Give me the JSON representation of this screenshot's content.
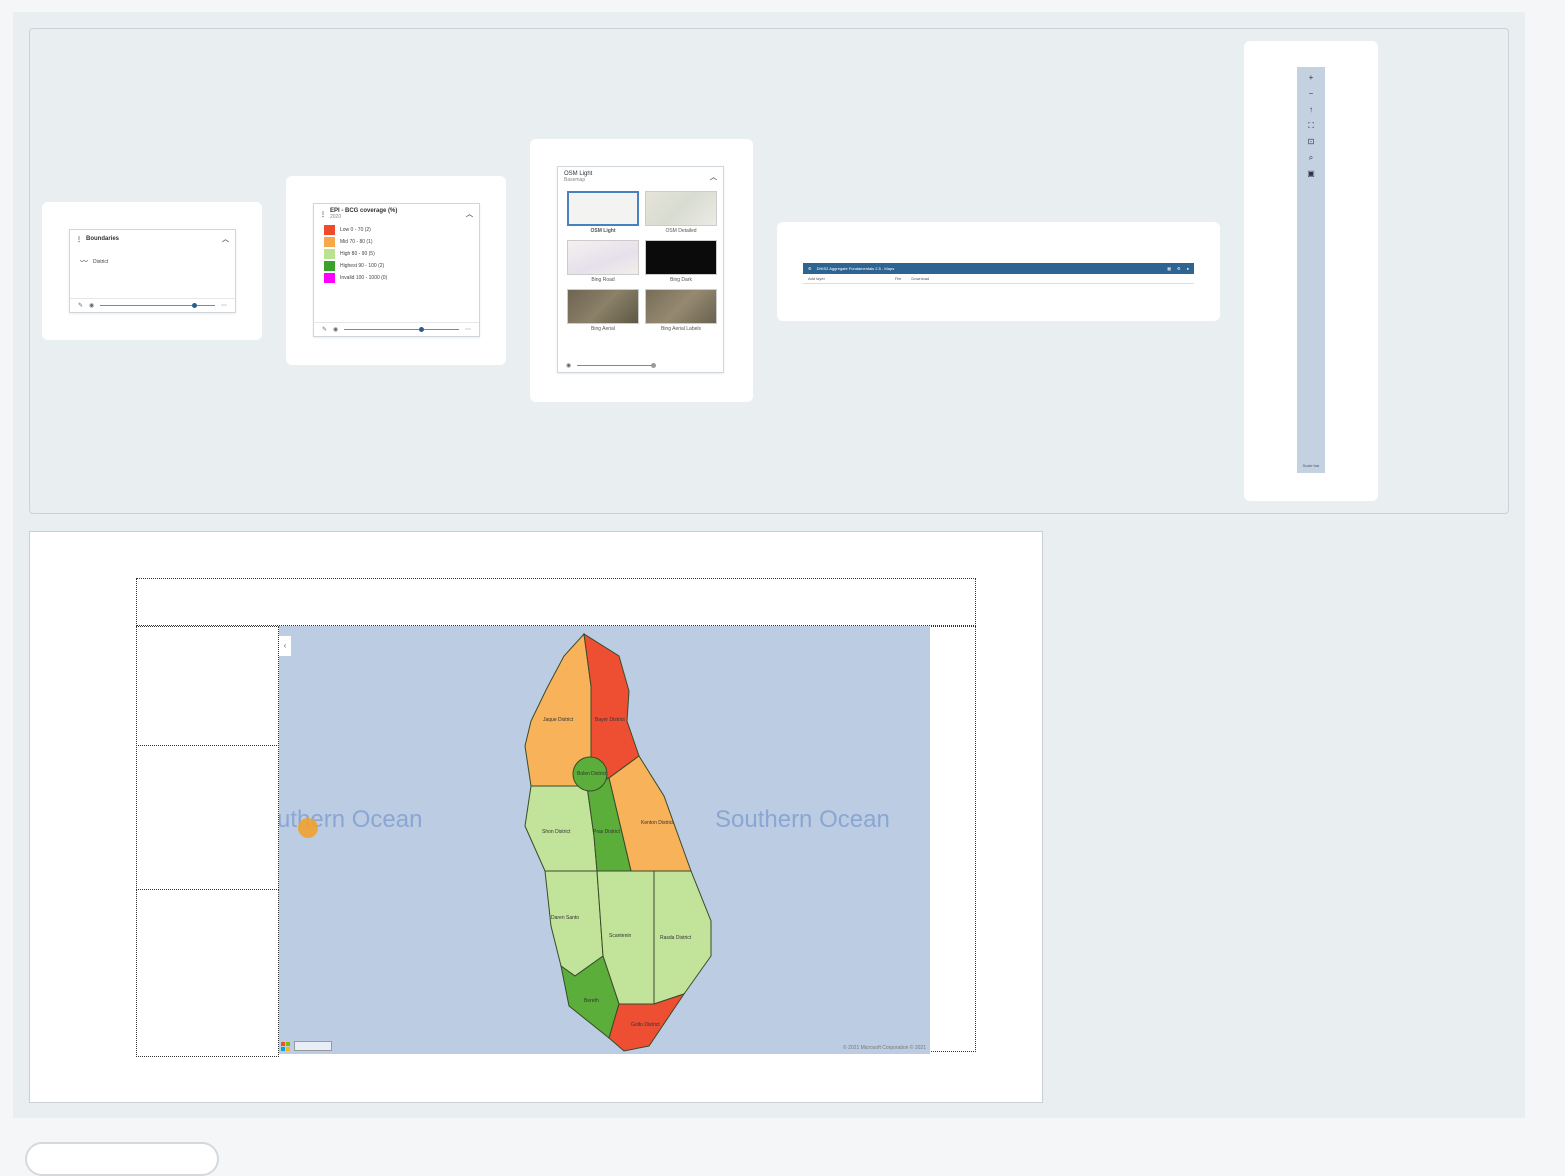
{
  "legend_boundaries": {
    "title": "Boundaries",
    "item": "District"
  },
  "legend_coverage": {
    "title": "EPI - BCG coverage (%)",
    "subtitle": "2020",
    "classes": [
      {
        "label": "Low 0 - 70 (2)",
        "color": "#ee4a2b"
      },
      {
        "label": "Mid 70 - 80 (1)",
        "color": "#f7a94a"
      },
      {
        "label": "High 80 - 90 (5)",
        "color": "#b9e38f"
      },
      {
        "label": "Highest 90 - 100 (2)",
        "color": "#3aa22b"
      },
      {
        "label": "Invalid 100 - 1000 (0)",
        "color": "#ff00ff"
      }
    ]
  },
  "basemap": {
    "title": "OSM Light",
    "subtitle": "Basemap",
    "options": [
      "OSM Light",
      "OSM Detailed",
      "Bing Road",
      "Bing Dark",
      "Bing Aerial",
      "Bing Aerial Labels"
    ]
  },
  "header_bar": {
    "title": "DHIS2 Aggregate Fundamentals 2.5 - Maps",
    "tab1": "Add layer",
    "tab2": "File",
    "tab3": "Download"
  },
  "vertical_toolbar": {
    "icons": [
      "+",
      "−",
      "↑",
      "⛶",
      "⊡",
      "⌕",
      "▣"
    ],
    "footer": "Scale bar"
  },
  "map": {
    "ocean_left": "uthern Ocean",
    "ocean_right": "Southern Ocean",
    "copyright": "© 2021 Microsoft Corporation © 2021",
    "districts": [
      "Jaque District",
      "Bayer District",
      "Bolen District",
      "Shon District",
      "Kenton District",
      "Pras District",
      "Daren Santo",
      "Scantenin",
      "Rasda District",
      "Bereth",
      "Golto District"
    ]
  }
}
